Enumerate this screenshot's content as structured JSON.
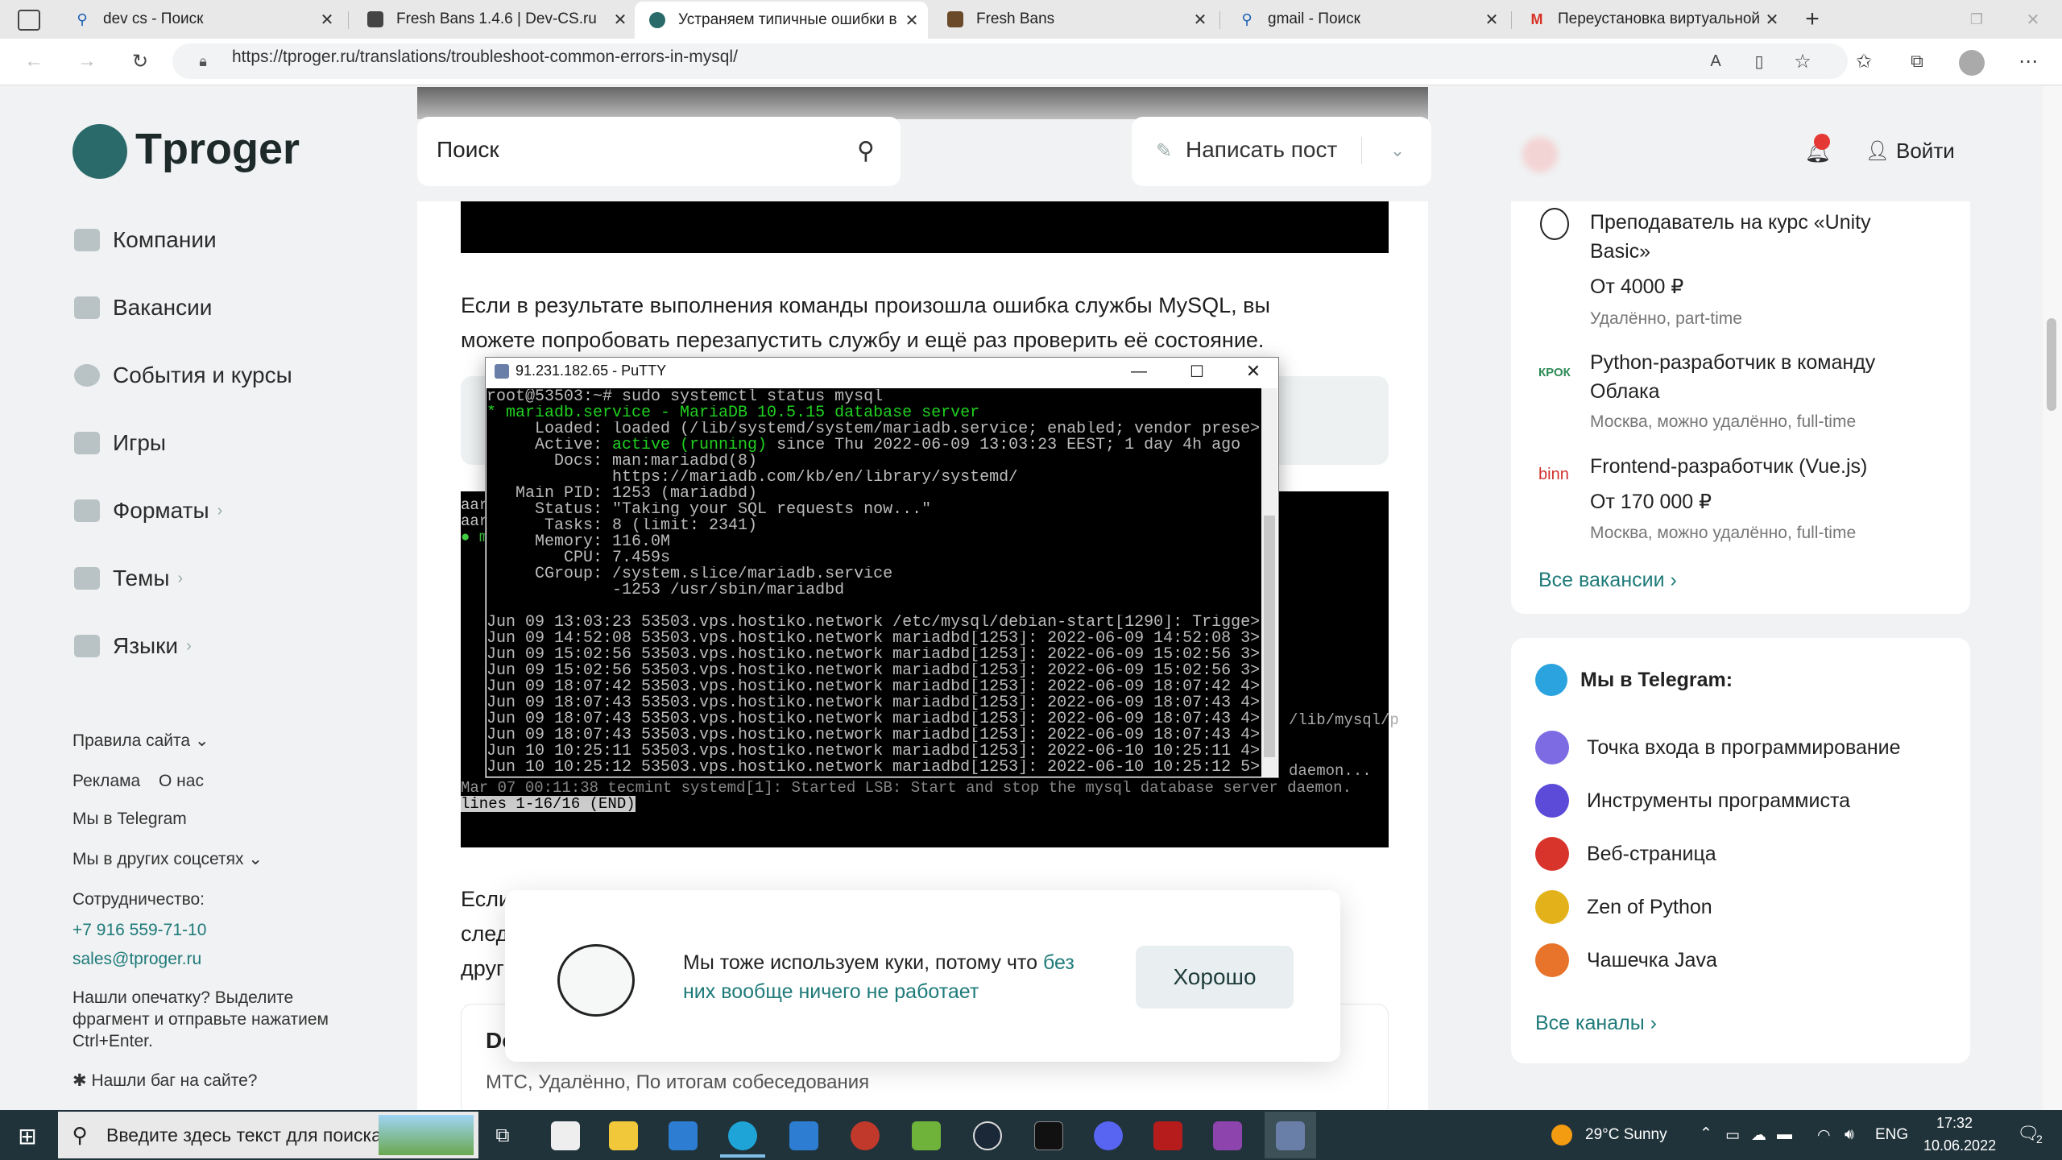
{
  "browser": {
    "tabs": [
      {
        "title": "dev cs - Поиск"
      },
      {
        "title": "Fresh Bans 1.4.6 | Dev-CS.ru"
      },
      {
        "title": "Устраняем типичные ошибки в"
      },
      {
        "title": "Fresh Bans"
      },
      {
        "title": "gmail - Поиск"
      },
      {
        "title": "Переустановка виртуальной ма"
      }
    ],
    "url": "https://tproger.ru/translations/troubleshoot-common-errors-in-mysql/"
  },
  "site": {
    "logo": "Tproger",
    "search_placeholder": "Поиск",
    "write_post": "Написать пост",
    "login": "Войти",
    "nav": [
      {
        "label": "Компании",
        "icon": "building-icon"
      },
      {
        "label": "Вакансии",
        "icon": "briefcase-icon"
      },
      {
        "label": "События и курсы",
        "icon": "clock-icon"
      },
      {
        "label": "Игры",
        "icon": "gamepad-icon"
      },
      {
        "label": "Форматы",
        "icon": "chat-icon",
        "chevron": "›"
      },
      {
        "label": "Темы",
        "icon": "document-icon",
        "chevron": "›"
      },
      {
        "label": "Языки",
        "icon": "terminal-icon",
        "chevron": "›"
      }
    ],
    "footer": {
      "rules": "Правила сайта",
      "ads": "Реклама",
      "about": "О нас",
      "telegram": "Мы в Telegram",
      "social": "Мы в других соцсетях",
      "coop": "Сотрудничество:",
      "phone": "+7 916 559-71-10",
      "email": "sales@tproger.ru",
      "typo": "Нашли опечатку? Выделите фрагмент и отправьте нажатием Ctrl+Enter.",
      "bug": "Нашли баг на сайте?"
    }
  },
  "article": {
    "para1_line1": "Если в результате выполнения команды произошла ошибка службы MySQL, вы",
    "para1_line2": "можете попробовать перезапустить службу и ещё раз проверить её состояние.",
    "para2_visible": [
      "Если",
      "след",
      "друг"
    ],
    "bg_term_lines": [
      "Mar 07 00:11:38 tecmint systemd[1]: Started LSB: Start and stop the mysql database server daemon.",
      "lines 1-16/16 (END)"
    ],
    "bg_term_frag": [
      "aar",
      "aar",
      "● m"
    ],
    "bg_term_right": [
      "/lib/mysql/p",
      "daemon..."
    ],
    "job_partial_title": "Do",
    "job_meta": "МТС, Удалённо, По итогам собеседования"
  },
  "putty": {
    "title": "91.231.182.65 - PuTTY",
    "lines": [
      "root@53503:~# sudo systemctl status mysql",
      "* mariadb.service - MariaDB 10.5.15 database server",
      "     Loaded: loaded (/lib/systemd/system/mariadb.service; enabled; vendor prese>",
      "     Active: active (running) since Thu 2022-06-09 13:03:23 EEST; 1 day 4h ago",
      "       Docs: man:mariadbd(8)",
      "             https://mariadb.com/kb/en/library/systemd/",
      "   Main PID: 1253 (mariadbd)",
      "     Status: \"Taking your SQL requests now...\"",
      "      Tasks: 8 (limit: 2341)",
      "     Memory: 116.0M",
      "        CPU: 7.459s",
      "     CGroup: /system.slice/mariadb.service",
      "             -1253 /usr/sbin/mariadbd",
      "",
      "Jun 09 13:03:23 53503.vps.hostiko.network /etc/mysql/debian-start[1290]: Trigge>",
      "Jun 09 14:52:08 53503.vps.hostiko.network mariadbd[1253]: 2022-06-09 14:52:08 3>",
      "Jun 09 15:02:56 53503.vps.hostiko.network mariadbd[1253]: 2022-06-09 15:02:56 3>",
      "Jun 09 15:02:56 53503.vps.hostiko.network mariadbd[1253]: 2022-06-09 15:02:56 3>",
      "Jun 09 18:07:42 53503.vps.hostiko.network mariadbd[1253]: 2022-06-09 18:07:42 4>",
      "Jun 09 18:07:43 53503.vps.hostiko.network mariadbd[1253]: 2022-06-09 18:07:43 4>",
      "Jun 09 18:07:43 53503.vps.hostiko.network mariadbd[1253]: 2022-06-09 18:07:43 4>",
      "Jun 09 18:07:43 53503.vps.hostiko.network mariadbd[1253]: 2022-06-09 18:07:43 4>",
      "Jun 10 10:25:11 53503.vps.hostiko.network mariadbd[1253]: 2022-06-10 10:25:11 4>",
      "Jun 10 10:25:12 53503.vps.hostiko.network mariadbd[1253]: 2022-06-10 10:25:12 5>"
    ]
  },
  "vacancies": {
    "items": [
      {
        "title_l1": "Преподаватель на курс «Unity",
        "title_l2": "Basic»",
        "salary": "От 4000 ₽",
        "meta": "Удалённо, part-time"
      },
      {
        "logo": "КРОК",
        "title_l1": "Python-разработчик в команду",
        "title_l2": "Облака",
        "meta": "Москва, можно удалённо, full-time"
      },
      {
        "logo": "binn",
        "title_l1": "Frontend-разработчик (Vue.js)",
        "salary": "От 170 000 ₽",
        "meta": "Москва, можно удалённо, full-time"
      }
    ],
    "all": "Все вакансии"
  },
  "telegram": {
    "title": "Мы в Telegram:",
    "channels": [
      "Точка входа в программирование",
      "Инструменты программиста",
      "Веб-страница",
      "Zen of Python",
      "Чашечка Java"
    ],
    "all": "Все каналы"
  },
  "cookie": {
    "text1": "Мы тоже используем куки, потому что ",
    "link1": "без",
    "link2": "них вообще ничего не работает",
    "ok": "Хорошо"
  },
  "taskbar": {
    "search": "Введите здесь текст для поиска",
    "weather": "29°C  Sunny",
    "lang": "ENG",
    "time": "17:32",
    "date": "10.06.2022",
    "notif": "2"
  }
}
